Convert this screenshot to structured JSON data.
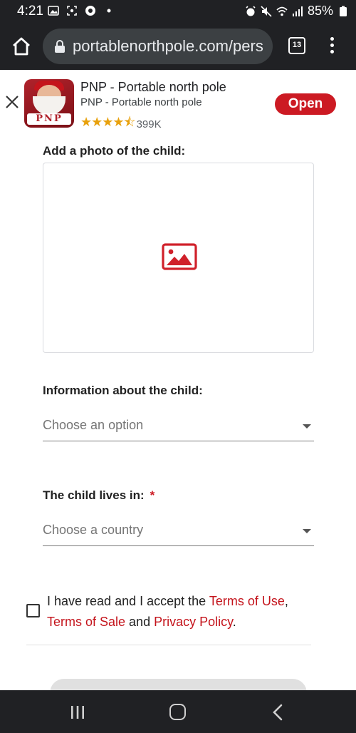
{
  "status_bar": {
    "time": "4:21",
    "battery": "85%",
    "icons_left": [
      "image-icon",
      "screenshot-icon",
      "chrome-icon",
      "dot-icon"
    ],
    "icons_right": [
      "alarm-icon",
      "mute-icon",
      "wifi-icon",
      "signal-icon",
      "battery-icon"
    ]
  },
  "browser": {
    "url": "portablenorthpole.com/pers",
    "tab_count": "13"
  },
  "app_banner": {
    "title": "PNP - Portable north pole",
    "subtitle": "PNP - Portable north pole",
    "rating_stars": "★★★★⯪",
    "rating_count": "399K",
    "open_label": "Open",
    "icon_text": "PNP"
  },
  "form": {
    "photo_label": "Add a photo of the child:",
    "info_label": "Information about the child:",
    "info_placeholder": "Choose an option",
    "lives_label": "The child lives in:",
    "required_marker": "*",
    "country_placeholder": "Choose a country",
    "terms": {
      "prefix": "I have read and I accept the ",
      "terms_of_use": "Terms of Use",
      "comma": ",",
      "terms_of_sale": "Terms of Sale",
      "and": " and ",
      "privacy_policy": "Privacy Policy",
      "period": "."
    }
  },
  "colors": {
    "accent": "#cc1a23",
    "link": "#c4141c",
    "chrome_dark": "#202124"
  }
}
